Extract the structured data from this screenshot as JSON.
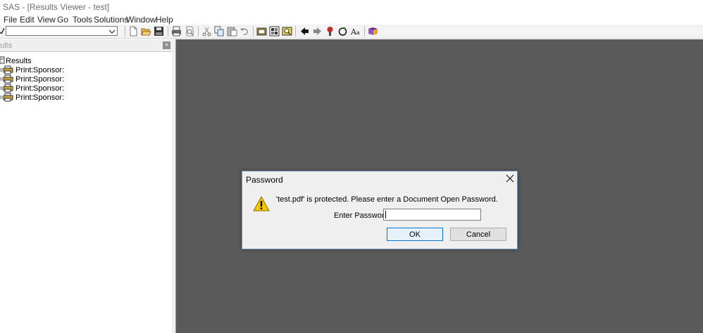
{
  "window": {
    "title": "SAS - [Results Viewer - test]"
  },
  "menu": {
    "items": [
      {
        "label": "File"
      },
      {
        "label": "Edit"
      },
      {
        "label": "View"
      },
      {
        "label": "Go"
      },
      {
        "label": "Tools"
      },
      {
        "label": "Solutions"
      },
      {
        "label": "Window"
      },
      {
        "label": "Help"
      }
    ]
  },
  "toolbar": {
    "command_combo": {
      "value": ""
    },
    "icons": [
      "new-document-icon",
      "open-folder-icon",
      "save-icon",
      "print-icon",
      "print-preview-icon",
      "cut-icon",
      "copy-icon",
      "paste-icon",
      "undo-icon",
      "results-icon",
      "explorer-icon",
      "find-icon",
      "back-arrow-icon",
      "forward-arrow-icon",
      "stop-icon",
      "refresh-icon",
      "font-icon",
      "help-book-icon"
    ]
  },
  "results_pane": {
    "header_title": "ults",
    "tree": {
      "root": "Results",
      "items": [
        {
          "prefix": "Print:",
          "name": "Sponsor:"
        },
        {
          "prefix": "Print:",
          "name": "Sponsor:"
        },
        {
          "prefix": "Print:",
          "name": "Sponsor:"
        },
        {
          "prefix": "Print:",
          "name": "Sponsor:"
        }
      ]
    }
  },
  "dialog": {
    "title": "Password",
    "message": "'test.pdf' is protected. Please enter a Document Open Password.",
    "password_label": "Enter Password:",
    "password_value": "",
    "ok_label": "OK",
    "cancel_label": "Cancel",
    "icon": "warning-icon"
  },
  "colors": {
    "workspace_bg": "#5a5a5a",
    "dialog_bg": "#f0f0f0",
    "ok_border": "#0078d7",
    "warning_yellow": "#f7c600"
  }
}
